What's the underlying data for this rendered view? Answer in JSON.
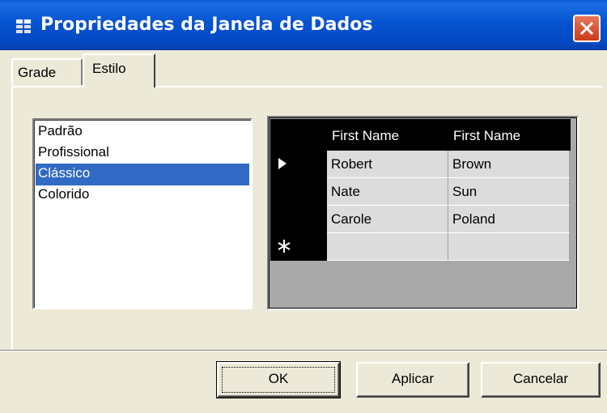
{
  "window": {
    "title": "Propriedades da Janela de Dados",
    "close_icon": "close-icon",
    "title_icon": "grid-properties-icon",
    "titlebar_color": "#0553cf"
  },
  "tabs": [
    {
      "label": "Grade",
      "active": false
    },
    {
      "label": "Estilo",
      "active": true
    }
  ],
  "style_list": {
    "items": [
      "Padrão",
      "Profissional",
      "Clássico",
      "Colorido"
    ],
    "selected": "Clássico",
    "selected_color": "#316ac5"
  },
  "preview": {
    "columns": [
      "First Name",
      "First Name"
    ],
    "rows": [
      {
        "marker": "current-row-arrow-icon",
        "cells": [
          "Robert",
          "Brown"
        ]
      },
      {
        "marker": "",
        "cells": [
          "Nate",
          "Sun"
        ]
      },
      {
        "marker": "",
        "cells": [
          "Carole",
          "Poland"
        ]
      },
      {
        "marker": "new-row-asterisk-icon",
        "cells": [
          "",
          ""
        ]
      }
    ],
    "header_color": "#000000",
    "cell_color": "#dcdcdc"
  },
  "buttons": {
    "ok": "OK",
    "apply": "Aplicar",
    "cancel": "Cancelar"
  }
}
